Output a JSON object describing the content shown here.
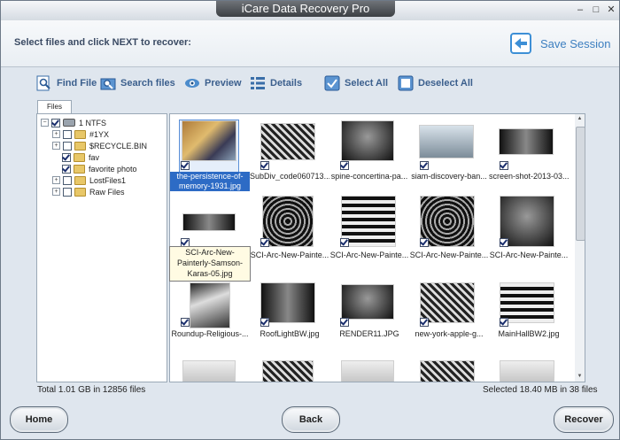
{
  "window": {
    "title": "iCare Data Recovery Pro"
  },
  "header": {
    "prompt": "Select files and click NEXT to recover:",
    "save_session": "Save Session"
  },
  "toolbar": {
    "find_file": "Find File",
    "search_files": "Search files",
    "preview": "Preview",
    "details": "Details",
    "select_all": "Select All",
    "deselect_all": "Deselect All"
  },
  "tab": {
    "files": "Files"
  },
  "tree": {
    "items": [
      {
        "label": "1 NTFS",
        "checked": true,
        "expander": "-",
        "icon": "disk-icon"
      },
      {
        "label": "#1YX",
        "checked": false,
        "expander": "+",
        "icon": "folder-icon"
      },
      {
        "label": "$RECYCLE.BIN",
        "checked": false,
        "expander": "+",
        "icon": "folder-icon"
      },
      {
        "label": "fav",
        "checked": true,
        "expander": "",
        "icon": "folder-icon"
      },
      {
        "label": "favorite photo",
        "checked": true,
        "expander": "",
        "icon": "folder-icon"
      },
      {
        "label": "LostFiles1",
        "checked": false,
        "expander": "+",
        "icon": "folder-icon"
      },
      {
        "label": "Raw Files",
        "checked": false,
        "expander": "+",
        "icon": "folder-icon"
      }
    ]
  },
  "files": [
    {
      "name": "the-persistence-of-memory-1931.jpg",
      "checked": true,
      "selected": true
    },
    {
      "name": "SubDiv_code060713...",
      "checked": true
    },
    {
      "name": "spine-concertina-pa...",
      "checked": true
    },
    {
      "name": "siam-discovery-ban...",
      "checked": true
    },
    {
      "name": "screen-shot-2013-03...",
      "checked": true
    },
    {
      "name": "SCI-Arc-New-Painterly-Samson-Karas-05.jpg",
      "checked": true
    },
    {
      "name": "SCI-Arc-New-Painte...",
      "checked": true
    },
    {
      "name": "SCI-Arc-New-Painte...",
      "checked": true
    },
    {
      "name": "SCI-Arc-New-Painte...",
      "checked": true
    },
    {
      "name": "SCI-Arc-New-Painte...",
      "checked": true
    },
    {
      "name": "Roundup-Religious-...",
      "checked": true
    },
    {
      "name": "RoofLightBW.jpg",
      "checked": true
    },
    {
      "name": "RENDER11.JPG",
      "checked": true
    },
    {
      "name": "new-york-apple-g...",
      "checked": true
    },
    {
      "name": "MainHallBW2.jpg",
      "checked": true
    }
  ],
  "tooltip": "SCI-Arc-New-Painterly-Samson-Karas-05.jpg",
  "status": {
    "left": "Total 1.01 GB in 12856 files",
    "right": "Selected 18.40 MB in 38 files"
  },
  "buttons": {
    "home": "Home",
    "back": "Back",
    "recover": "Recover"
  }
}
